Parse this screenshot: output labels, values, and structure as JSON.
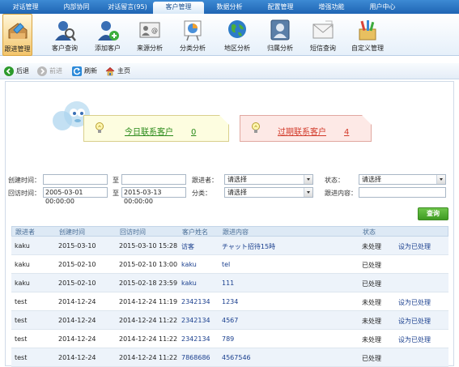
{
  "topnav": {
    "tabs": [
      "对话管理",
      "内部协同",
      "对话留言(95)",
      "客户管理",
      "数据分析",
      "配置管理",
      "增强功能",
      "用户中心"
    ],
    "active_index": 3
  },
  "iconbar": {
    "items": [
      {
        "label": "跟进管理",
        "icon": "follow-up-icon"
      },
      {
        "label": "客户查询",
        "icon": "customer-search-icon"
      },
      {
        "label": "添加客户",
        "icon": "add-customer-icon"
      },
      {
        "label": "来源分析",
        "icon": "source-analysis-icon"
      },
      {
        "label": "分类分析",
        "icon": "category-analysis-icon"
      },
      {
        "label": "地区分析",
        "icon": "region-analysis-icon"
      },
      {
        "label": "归属分析",
        "icon": "owner-analysis-icon"
      },
      {
        "label": "短信查询",
        "icon": "sms-query-icon"
      },
      {
        "label": "自定义管理",
        "icon": "custom-management-icon"
      }
    ],
    "active_index": 0
  },
  "navbar": {
    "back": "后退",
    "forward": "前进",
    "refresh": "刷新",
    "home": "主页"
  },
  "cards": {
    "today_label": "今日联系客户",
    "today_count": "0",
    "overdue_label": "过期联系客户",
    "overdue_count": "4"
  },
  "filter": {
    "created_label": "创建时间：",
    "to1": "至",
    "follower_label": "跟进者：",
    "follower_value": "请选择",
    "status_label": "状态：",
    "status_value": "请选择",
    "callback_label": "回访时间：",
    "callback_from": "2005-03-01 00:00:00",
    "to2": "至",
    "callback_to": "2015-03-13 00:00:00",
    "category_label": "分类：",
    "category_value": "请选择",
    "content_label": "跟进内容：",
    "query_button": "查询"
  },
  "table": {
    "headers": [
      "跟进者",
      "创建时间",
      "回访时间",
      "客户姓名",
      "跟进内容",
      "状态",
      ""
    ],
    "rows": [
      {
        "follower": "kaku",
        "created": "2015-03-10",
        "callback": "2015-03-10 15:28",
        "name": "访客",
        "content": "チャット招待15時",
        "status": "未处理",
        "action": "设为已处理"
      },
      {
        "follower": "kaku",
        "created": "2015-02-10",
        "callback": "2015-02-10 13:00",
        "name": "kaku",
        "content": "tel",
        "status": "已处理",
        "action": ""
      },
      {
        "follower": "kaku",
        "created": "2015-02-10",
        "callback": "2015-02-18 23:59",
        "name": "kaku",
        "content": "111",
        "status": "已处理",
        "action": ""
      },
      {
        "follower": "test",
        "created": "2014-12-24",
        "callback": "2014-12-24 11:19",
        "name": "2342134",
        "content": "1234",
        "status": "未处理",
        "action": "设为已处理"
      },
      {
        "follower": "test",
        "created": "2014-12-24",
        "callback": "2014-12-24 11:22",
        "name": "2342134",
        "content": "4567",
        "status": "未处理",
        "action": "设为已处理"
      },
      {
        "follower": "test",
        "created": "2014-12-24",
        "callback": "2014-12-24 11:22",
        "name": "2342134",
        "content": "789",
        "status": "未处理",
        "action": "设为已处理"
      },
      {
        "follower": "test",
        "created": "2014-12-24",
        "callback": "2014-12-24 11:22",
        "name": "7868686",
        "content": "4567546",
        "status": "已处理",
        "action": ""
      }
    ]
  }
}
